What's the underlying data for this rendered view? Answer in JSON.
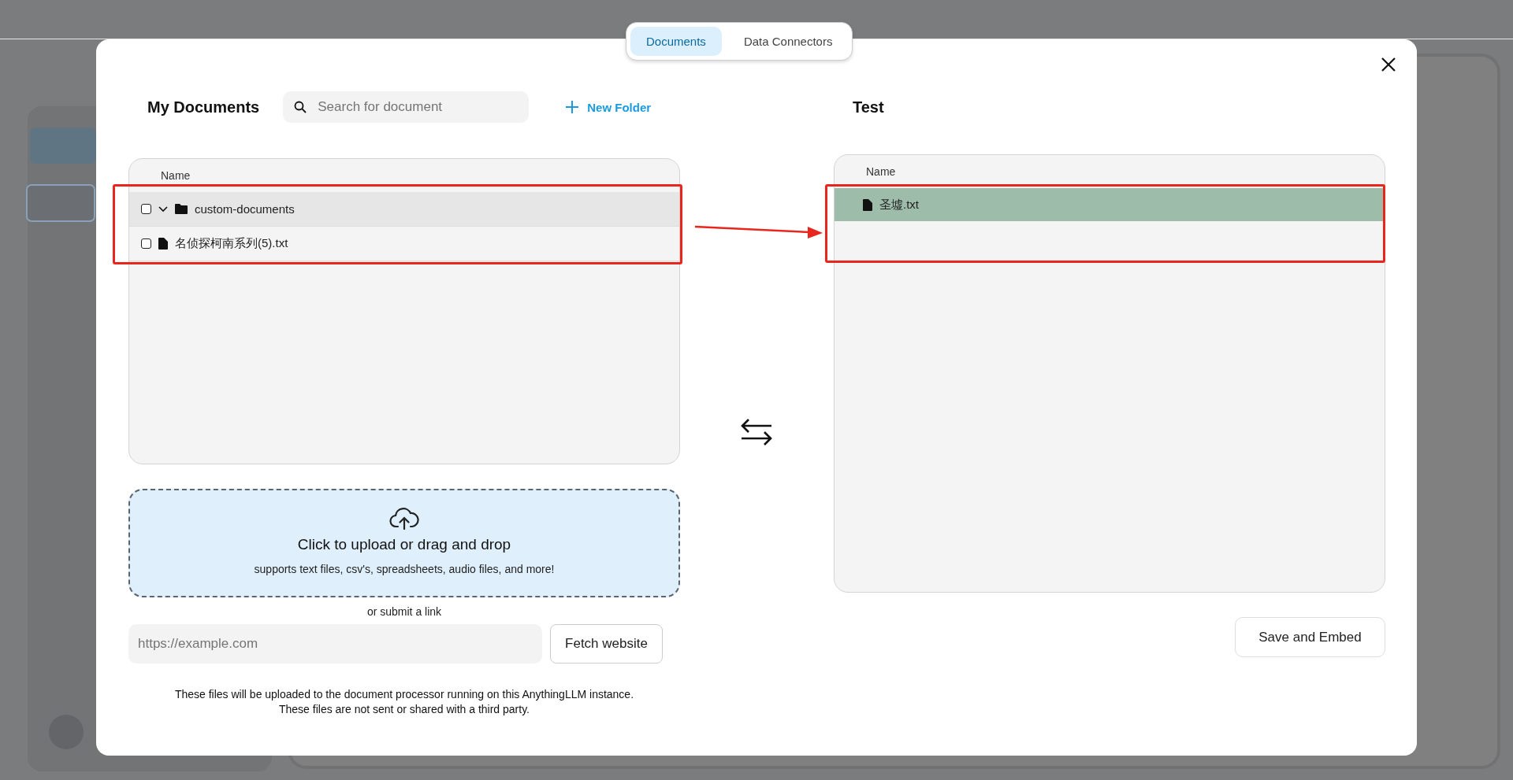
{
  "tabs": [
    {
      "label": "Documents",
      "selected": true
    },
    {
      "label": "Data Connectors",
      "selected": false
    }
  ],
  "my_documents": {
    "title": "My Documents",
    "search": {
      "placeholder": "Search for document"
    },
    "new_folder": "New Folder",
    "table": {
      "columns": [
        "Name"
      ],
      "rows": [
        {
          "kind": "folder",
          "name": "custom-documents",
          "checked": false,
          "expanded": true,
          "selected": true
        },
        {
          "kind": "file",
          "name": "名侦探柯南系列(5).txt",
          "checked": false,
          "selected": false
        }
      ]
    }
  },
  "upload": {
    "title": "Click to upload or drag and drop",
    "subtitle": "supports text files, csv's, spreadsheets, audio files, and more!"
  },
  "link": {
    "label": "or submit a link",
    "placeholder": "https://example.com",
    "button": "Fetch website"
  },
  "notice": [
    "These files will be uploaded to the document processor running on this AnythingLLM instance.",
    "These files are not sent or shared with a third party."
  ],
  "workspace": {
    "title": "Test",
    "table": {
      "columns": [
        "Name"
      ],
      "rows": [
        {
          "kind": "file",
          "name": "圣墟.txt",
          "selected": true
        }
      ]
    }
  },
  "save_button": "Save and Embed"
}
